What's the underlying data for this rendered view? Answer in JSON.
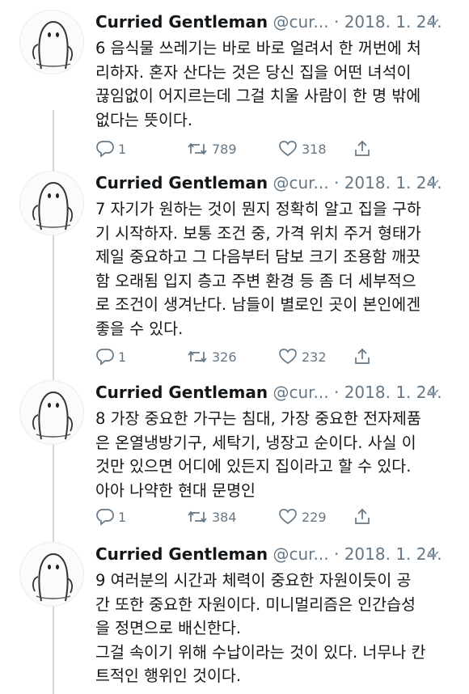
{
  "tweets": [
    {
      "author": "Curried Gentleman",
      "handle": "@cur...",
      "dot": "·",
      "date": "2018. 1. 24.",
      "text": "6 음식물 쓰레기는 바로 바로 얼려서 한 꺼번에 처\n리하자. 혼자 산다는 것은 당신 집을 어떤 녀석이\n끊임없이 어지르는데 그걸 치울 사람이 한 명 밖에\n없다는 뜻이다.",
      "replies": "1",
      "retweets": "789",
      "likes": "318"
    },
    {
      "author": "Curried Gentleman",
      "handle": "@cur...",
      "dot": "·",
      "date": "2018. 1. 24.",
      "text": "7 자기가 원하는 것이 뭔지 정확히 알고 집을 구하\n기 시작하자. 보통 조건 중, 가격 위치 주거 형태가\n제일 중요하고 그 다음부터 담보 크기 조용함 깨끗\n함 오래됨 입지 층고 주변 환경 등 좀 더 세부적으\n로 조건이 생겨난다. 남들이 별로인 곳이 본인에겐\n좋을 수 있다.",
      "replies": "1",
      "retweets": "326",
      "likes": "232"
    },
    {
      "author": "Curried Gentleman",
      "handle": "@cur...",
      "dot": "·",
      "date": "2018. 1. 24.",
      "text": "8 가장 중요한 가구는 침대, 가장 중요한 전자제품\n은 온열냉방기구, 세탁기, 냉장고 순이다. 사실 이\n것만 있으면 어디에 있든지 집이라고 할 수 있다.\n아아 나약한 현대 문명인",
      "replies": "1",
      "retweets": "384",
      "likes": "229"
    },
    {
      "author": "Curried Gentleman",
      "handle": "@cur...",
      "dot": "·",
      "date": "2018. 1. 24.",
      "text": "9 여러분의 시간과 체력이 중요한 자원이듯이 공\n간 또한 중요한 자원이다. 미니멀리즘은 인간습성\n을 정면으로 배신한다.\n그걸 속이기 위해 수납이라는 것이 있다. 너무나 칸\n트적인 행위인 것이다."
    }
  ],
  "icons": {
    "reply": "reply-icon",
    "retweet": "retweet-icon",
    "like": "heart-icon",
    "share": "share-icon",
    "caret": "chevron-down-icon"
  }
}
